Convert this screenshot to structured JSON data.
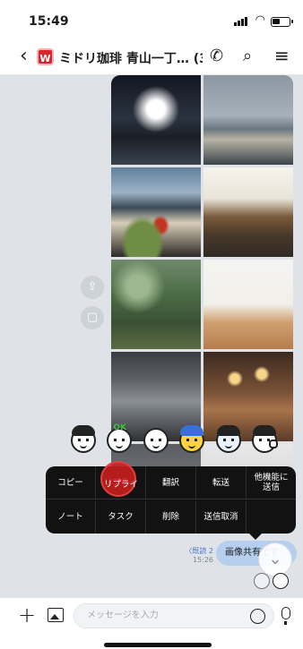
{
  "status_bar": {
    "time": "15:49"
  },
  "header": {
    "logo_text": "W",
    "title": "ミドリ珈琲 青山一丁… (3)",
    "icons": [
      "back-chevron-icon",
      "phone-icon",
      "search-icon",
      "menu-icon"
    ]
  },
  "photos": [
    {
      "name": "photo-night-building"
    },
    {
      "name": "photo-city-skyline"
    },
    {
      "name": "photo-food-table"
    },
    {
      "name": "photo-cafe-interior"
    },
    {
      "name": "photo-forest"
    },
    {
      "name": "photo-gallery-room"
    },
    {
      "name": "photo-industrial-interior"
    },
    {
      "name": "photo-bakery-counter"
    },
    {
      "name": "photo-partial-left"
    },
    {
      "name": "photo-partial-right"
    }
  ],
  "side_buttons": [
    "share-icon",
    "save-icon"
  ],
  "reactions": [
    "react-surprised",
    "react-ok",
    "react-clap",
    "react-happy",
    "react-sad",
    "react-thumbs-up"
  ],
  "reaction_ok_text": "OK",
  "context_menu": {
    "row1": [
      "コピー",
      "リプライ",
      "翻訳",
      "転送",
      "他機能に\n送信"
    ],
    "row2": [
      "ノート",
      "タスク",
      "削除",
      "送信取消",
      ""
    ]
  },
  "message": {
    "read_label": "既読 2",
    "read_prefix": "〈",
    "time": "15:26",
    "text": "画像共有です"
  },
  "input_bar": {
    "placeholder": "メッセージを入力"
  },
  "colors": {
    "highlight": "#d21e1e",
    "bubble": "#b6cfee",
    "read": "#4a73d0",
    "logo": "#d8232a"
  }
}
